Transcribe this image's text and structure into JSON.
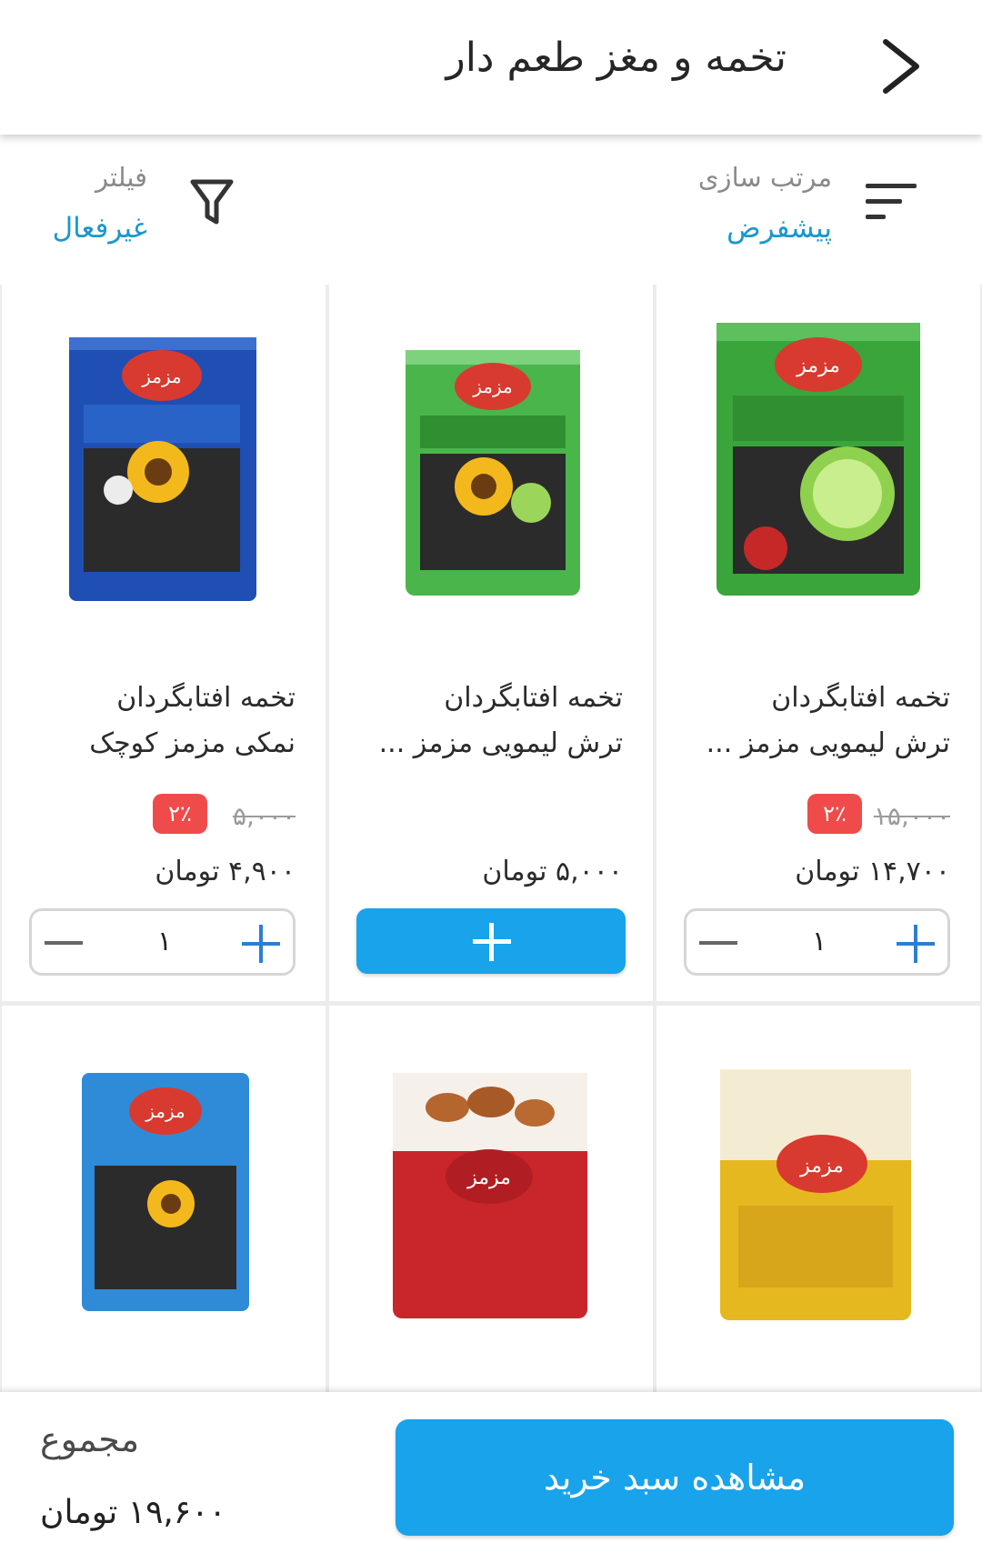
{
  "header": {
    "title": "تخمه و مغز طعم دار"
  },
  "toolbar": {
    "sort_label": "مرتب سازی",
    "sort_value": "پیشفرض",
    "filter_label": "فیلتر",
    "filter_value": "غیرفعال"
  },
  "products": [
    {
      "name_line1": "تخمه افتابگردان",
      "name_line2": "ترش لیمویی مزمز ...",
      "old_price": "۱۵,۰۰۰",
      "discount": "۲٪",
      "price": "۱۴,۷۰۰ تومان",
      "quantity": "۱"
    },
    {
      "name_line1": "تخمه افتابگردان",
      "name_line2": "ترش لیمویی مزمز ...",
      "price": "۵,۰۰۰ تومان"
    },
    {
      "name_line1": "تخمه افتابگردان",
      "name_line2": "نمکی مزمز کوچک",
      "old_price": "۵,۰۰۰",
      "discount": "۲٪",
      "price": "۴,۹۰۰ تومان",
      "quantity": "۱"
    },
    {
      "image": "cashew-package"
    },
    {
      "image": "almond-package"
    },
    {
      "image": "salted-sunflower-package"
    }
  ],
  "bottom": {
    "total_label": "مجموع",
    "total_value": "۱۹,۶۰۰ تومان",
    "cart_button": "مشاهده سبد خرید"
  },
  "colors": {
    "accent": "#18a3ea",
    "link": "#1b98cd",
    "badge": "#ef4b4b"
  }
}
